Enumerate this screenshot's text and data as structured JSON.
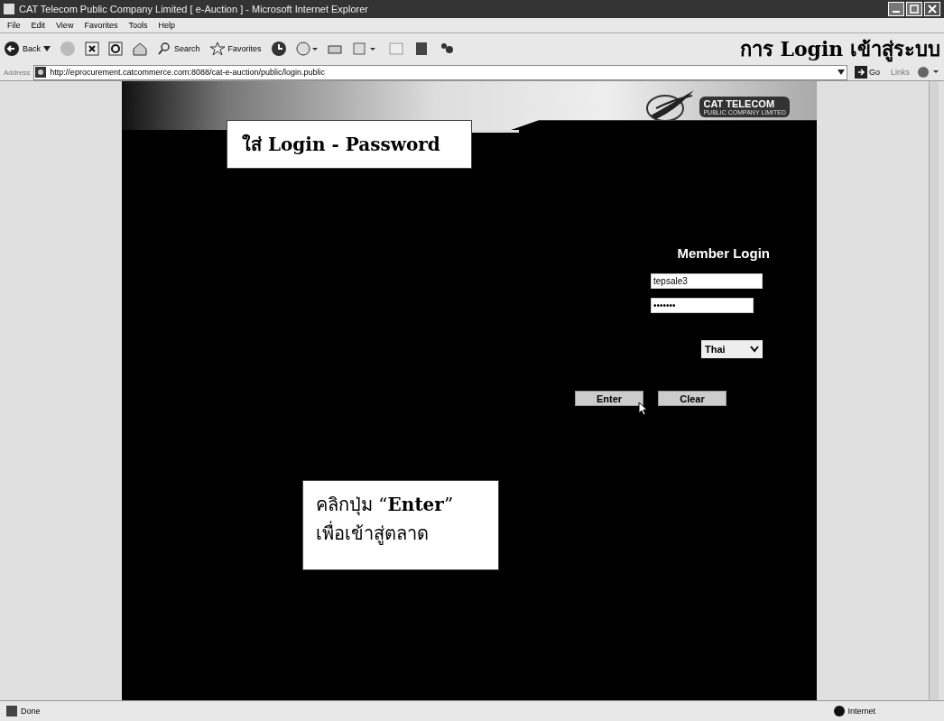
{
  "window": {
    "title": "CAT Telecom Public Company Limited [ e-Auction ] - Microsoft Internet Explorer"
  },
  "menu": [
    "File",
    "Edit",
    "View",
    "Favorites",
    "Tools",
    "Help"
  ],
  "toolbar": {
    "back": "Back",
    "search": "Search",
    "favorites": "Favorites"
  },
  "annotation_title": "การ Login เข้าสู่ระบบ",
  "address": {
    "label": "Address",
    "url": "http://eprocurement.catcommerce.com:8088/cat-e-auction/public/login.public",
    "go": "Go",
    "links": "Links"
  },
  "logo": {
    "name": "CAT TELECOM",
    "subtitle": "PUBLIC COMPANY LIMITED"
  },
  "login": {
    "heading": "Member Login",
    "username": "tepsale3",
    "password": "•••••••",
    "language": "Thai",
    "buttons": [
      "Enter",
      "Clear"
    ]
  },
  "callouts": [
    {
      "kind": "top",
      "text": "ใส่ Login - Password"
    },
    {
      "kind": "bottom",
      "text": "คลิกปุ่ม “**Enter**”\nเพื่อเข้าสู่ตลาด"
    }
  ],
  "status_bar": {
    "text": "Done",
    "zone": "Internet"
  }
}
